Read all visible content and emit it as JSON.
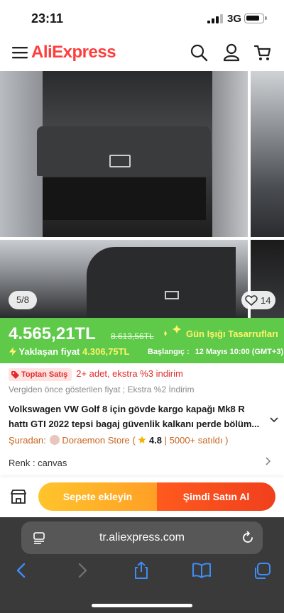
{
  "status_bar": {
    "time": "23:11",
    "network": "3G"
  },
  "header": {
    "logo": "AliExpress"
  },
  "gallery": {
    "counter": "5/8",
    "likes": "14"
  },
  "price_banner": {
    "price": "4.565,21TL",
    "original_price": "8.613,56TL",
    "promo_name": "Gün Işığı Tasarrufları",
    "approaching_label": "Yaklaşan fiyat",
    "approaching_price": "4.306,75TL",
    "start_label": "Başlangıç :",
    "start_date": "12 Mayıs 10:00 (GMT+3)"
  },
  "wholesale": {
    "tag": "Toptan Satış",
    "text": "2+ adet, ekstra %3 indirim"
  },
  "tax_note": "Vergiden önce gösterilen fiyat ; Ekstra %2 İndirim",
  "product": {
    "title_line1": "Volkswagen VW Golf 8 için gövde kargo kapağı Mk8 R",
    "title_line2": "hattı GTI 2022 tepsi bagaj güvenlik kalkanı perde bölüm..."
  },
  "store": {
    "prefix": "Şuradan:",
    "name": "Doraemon Store (",
    "rating": "4.8",
    "sold": "| 5000+ satıldı )"
  },
  "variant": {
    "label": "Renk : canvas"
  },
  "actions": {
    "add_to_cart": "Sepete ekleyin",
    "buy_now": "Şimdi Satın Al"
  },
  "browser": {
    "url": "tr.aliexpress.com"
  },
  "colors": {
    "brand_red": "#ff3d3d",
    "banner_green": "#5fc94a",
    "cart_orange": "#ffb02a",
    "buy_red": "#f0401d",
    "store_orange": "#c9631b"
  }
}
